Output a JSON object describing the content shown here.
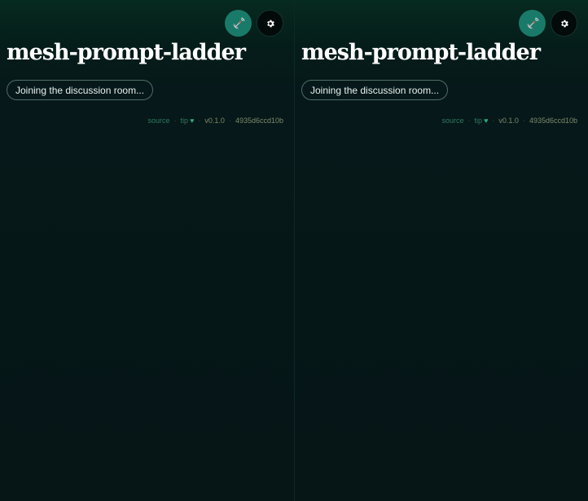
{
  "panes": [
    {
      "title": "mesh-prompt-ladder",
      "status": "Joining the discussion room...",
      "footer": {
        "source_label": "source",
        "separator": "·",
        "tip_label": "tip",
        "heart": "♥",
        "version": "v0.1.0",
        "hash": "4935d6ccd10b"
      }
    },
    {
      "title": "mesh-prompt-ladder",
      "status": "Joining the discussion room...",
      "footer": {
        "source_label": "source",
        "separator": "·",
        "tip_label": "tip",
        "heart": "♥",
        "version": "v0.1.0",
        "hash": "4935d6ccd10b"
      }
    }
  ],
  "icons": {
    "radar": "satellite-dish-icon",
    "settings": "gear-icon"
  },
  "colors": {
    "background": "#061617",
    "accent": "#1a7a69",
    "link": "#2f7a60",
    "muted": "#7d8a6a"
  }
}
